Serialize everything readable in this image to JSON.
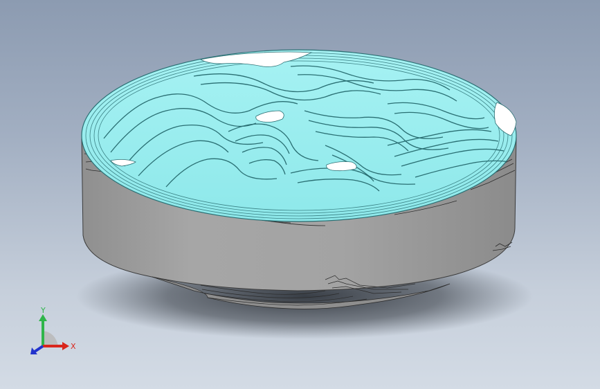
{
  "viewport": {
    "background_top": "#8c9bb1",
    "background_bottom": "#d3dbe5"
  },
  "model": {
    "side_color": "#a9a9a9",
    "top_color": "#97eef0",
    "terrace_line_color": "#2a6f73",
    "snow_color": "#ffffff"
  },
  "triad": {
    "x_label": "X",
    "y_label": "Y",
    "x_color": "#d9261c",
    "y_color": "#2fb54a",
    "z_color": "#2233cc"
  }
}
